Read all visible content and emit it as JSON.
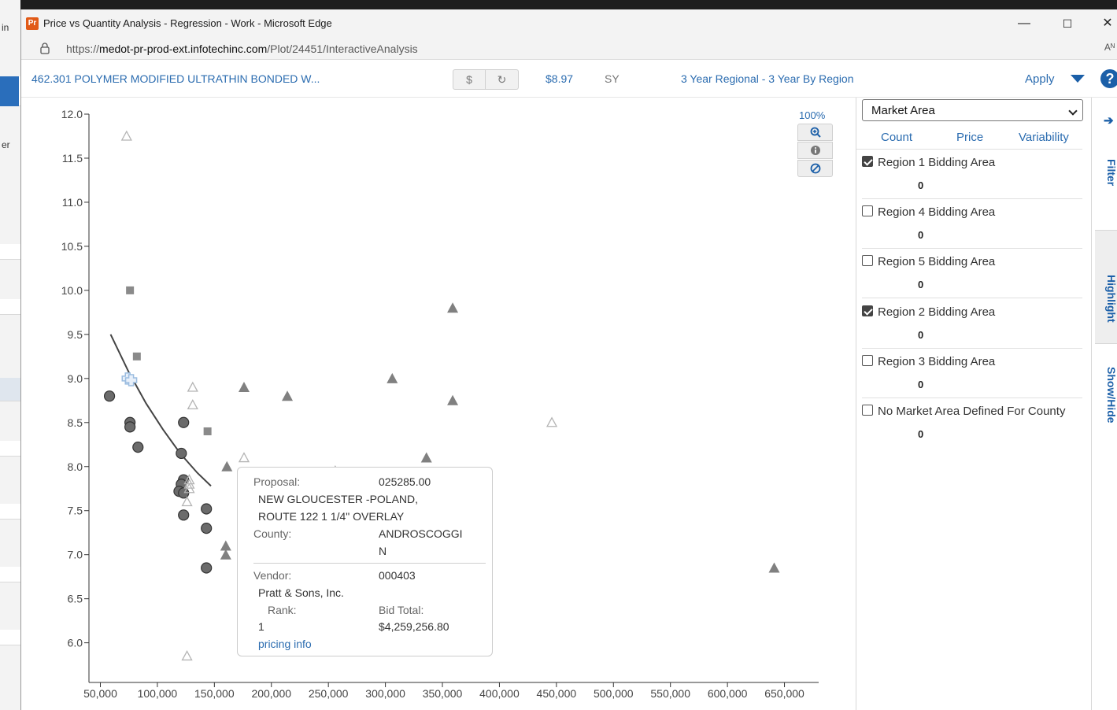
{
  "background_app": {
    "partial_label_1": "in",
    "partial_label_2": "er"
  },
  "window": {
    "title": "Price vs Quantity Analysis - Regression - Work - Microsoft Edge",
    "app_icon_text": "Pr",
    "minimize": "—",
    "maximize": "☐",
    "close": "✕"
  },
  "address": {
    "scheme": "https://",
    "host": "medot-pr-prod-ext.infotechinc.com",
    "path": "/Plot/24451/InteractiveAnalysis",
    "reader": "Aᴺ"
  },
  "header": {
    "item_title": "462.301 POLYMER MODIFIED ULTRATHIN BONDED W...",
    "dollar_label": "$",
    "refresh_label": "↻",
    "price": "$8.97",
    "unit": "SY",
    "period": "3 Year Regional - 3 Year By Region",
    "apply_label": "Apply",
    "help_label": "?"
  },
  "zoom": {
    "level": "100%",
    "zoom_in_icon": "⊕",
    "info_icon": "●",
    "reset_icon": "⊘"
  },
  "chart_data": {
    "type": "scatter",
    "title": "",
    "xlabel": "",
    "ylabel": "",
    "xlim": [
      40000,
      680000
    ],
    "ylim": [
      5.55,
      12.0
    ],
    "x_ticks": [
      50000,
      100000,
      150000,
      200000,
      250000,
      300000,
      350000,
      400000,
      450000,
      500000,
      550000,
      600000,
      650000
    ],
    "x_tick_labels": [
      "50,000",
      "100,000",
      "150,000",
      "200,000",
      "250,000",
      "300,000",
      "350,000",
      "400,000",
      "450,000",
      "500,000",
      "550,000",
      "600,000",
      "650,000"
    ],
    "y_ticks": [
      6.0,
      6.5,
      7.0,
      7.5,
      8.0,
      8.5,
      9.0,
      9.5,
      10.0,
      10.5,
      11.0,
      11.5,
      12.0
    ],
    "y_tick_labels": [
      "6.0",
      "6.5",
      "7.0",
      "7.5",
      "8.0",
      "8.5",
      "9.0",
      "9.5",
      "10.0",
      "10.5",
      "11.0",
      "11.5",
      "12.0"
    ],
    "grid": false,
    "series": [
      {
        "marker": "circle",
        "color": "#6b6b6b",
        "points": [
          [
            58000,
            8.8
          ],
          [
            76000,
            8.5
          ],
          [
            76000,
            8.45
          ],
          [
            83000,
            8.22
          ],
          [
            123000,
            8.5
          ],
          [
            121000,
            8.15
          ],
          [
            123000,
            7.85
          ],
          [
            121000,
            7.8
          ],
          [
            119000,
            7.72
          ],
          [
            123000,
            7.7
          ],
          [
            123000,
            7.45
          ],
          [
            143000,
            7.52
          ],
          [
            143000,
            7.3
          ],
          [
            143000,
            6.85
          ]
        ]
      },
      {
        "marker": "square",
        "color": "#8a8a8a",
        "points": [
          [
            76000,
            10.0
          ],
          [
            82000,
            9.25
          ],
          [
            144000,
            8.4
          ]
        ]
      },
      {
        "marker": "triangle",
        "color": "#808080",
        "points": [
          [
            359000,
            9.8
          ],
          [
            306000,
            9.0
          ],
          [
            176000,
            8.9
          ],
          [
            214000,
            8.8
          ],
          [
            359000,
            8.75
          ],
          [
            336000,
            8.1
          ],
          [
            161000,
            8.0
          ],
          [
            160000,
            7.1
          ],
          [
            160000,
            7.0
          ],
          [
            641000,
            6.85
          ]
        ]
      },
      {
        "marker": "triangle-open",
        "color": "#b4b4b4",
        "points": [
          [
            73000,
            11.75
          ],
          [
            131000,
            8.9
          ],
          [
            131000,
            8.7
          ],
          [
            176000,
            8.1
          ],
          [
            256000,
            7.95
          ],
          [
            446000,
            8.5
          ],
          [
            128000,
            7.85
          ],
          [
            128000,
            7.8
          ],
          [
            128000,
            7.75
          ],
          [
            126000,
            7.6
          ],
          [
            126000,
            5.85
          ]
        ]
      },
      {
        "marker": "cross",
        "color": "#9cbde0",
        "points": [
          [
            74000,
            9.0
          ],
          [
            77000,
            8.98
          ]
        ]
      }
    ],
    "regression_line": [
      [
        59000,
        9.5
      ],
      [
        75000,
        9.07
      ],
      [
        90000,
        8.72
      ],
      [
        105000,
        8.42
      ],
      [
        120000,
        8.15
      ],
      [
        135000,
        7.93
      ],
      [
        147000,
        7.78
      ]
    ]
  },
  "tooltip": {
    "proposal_label": "Proposal:",
    "proposal_value": "025285.00",
    "description_line1": "NEW GLOUCESTER -POLAND,",
    "description_line2": "ROUTE 122 1 1/4\" OVERLAY",
    "county_label": "County:",
    "county_value_line1": "ANDROSCOGGI",
    "county_value_line2": "N",
    "vendor_label": "Vendor:",
    "vendor_value": "000403",
    "vendor_name": "Pratt & Sons, Inc.",
    "rank_label": "Rank:",
    "rank_value": "1",
    "bid_total_label": "Bid Total:",
    "bid_total_value": "$4,259,256.80",
    "link_label": "pricing info"
  },
  "panel": {
    "select_value": "Market Area",
    "tabs": [
      "Count",
      "Price",
      "Variability"
    ],
    "regions": [
      {
        "label": "Region 1 Bidding Area",
        "count": "0",
        "checked": true
      },
      {
        "label": "Region 4 Bidding Area",
        "count": "0",
        "checked": false
      },
      {
        "label": "Region 5 Bidding Area",
        "count": "0",
        "checked": false
      },
      {
        "label": "Region 2 Bidding Area",
        "count": "0",
        "checked": true
      },
      {
        "label": "Region 3 Bidding Area",
        "count": "0",
        "checked": false
      },
      {
        "label": "No Market Area Defined For County",
        "count": "0",
        "checked": false
      }
    ]
  },
  "side_tabs": {
    "arrow": "➔",
    "filter": "Filter",
    "highlight": "Highlight",
    "show_hide": "Show/Hide"
  }
}
